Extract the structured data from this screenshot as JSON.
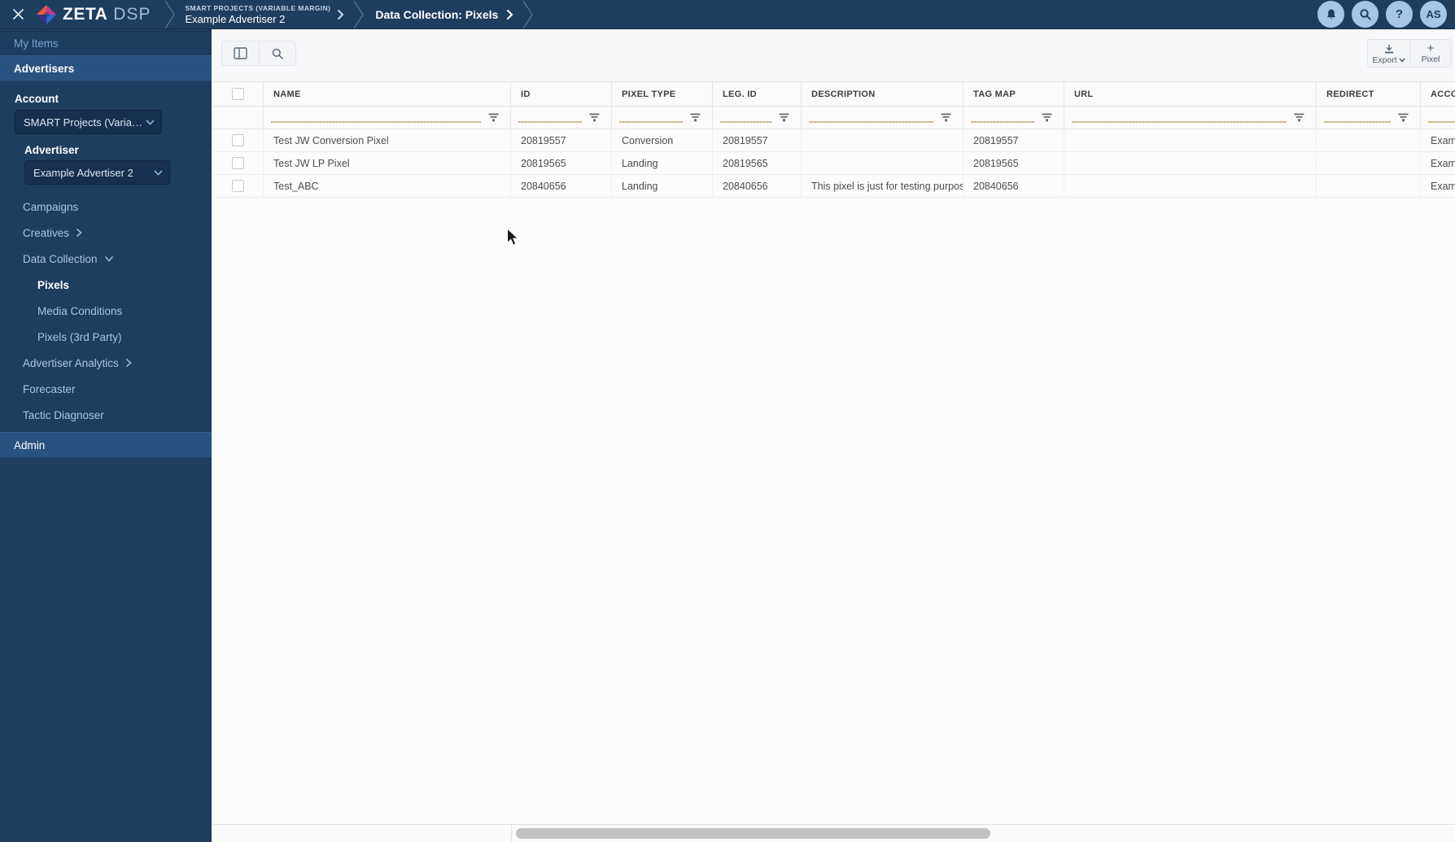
{
  "topbar": {
    "brand_zeta": "ZETA",
    "brand_dsp": "DSP",
    "breadcrumb": {
      "account": "SMART PROJECTS (VARIABLE MARGIN)",
      "advertiser": "Example Advertiser 2",
      "page": "Data Collection: Pixels"
    },
    "help_glyph": "?",
    "avatar": "AS"
  },
  "sidebar": {
    "my_items": "My Items",
    "advertisers": "Advertisers",
    "account_label": "Account",
    "account_value": "SMART Projects (Variable M...",
    "advertiser_label": "Advertiser",
    "advertiser_value": "Example Advertiser 2",
    "items": [
      {
        "label": "Campaigns"
      },
      {
        "label": "Creatives"
      },
      {
        "label": "Data Collection"
      },
      {
        "label": "Pixels"
      },
      {
        "label": "Media Conditions"
      },
      {
        "label": "Pixels (3rd Party)"
      },
      {
        "label": "Advertiser Analytics"
      },
      {
        "label": "Forecaster"
      },
      {
        "label": "Tactic Diagnoser"
      }
    ],
    "admin": "Admin"
  },
  "toolbar": {
    "export_label": "Export",
    "pixel_label": "Pixel",
    "plus_glyph": "+"
  },
  "table": {
    "columns": [
      "NAME",
      "ID",
      "PIXEL TYPE",
      "LEG. ID",
      "DESCRIPTION",
      "TAG MAP",
      "URL",
      "REDIRECT",
      "ACCOUNT"
    ],
    "rows": [
      {
        "name": "Test JW Conversion Pixel",
        "id": "20819557",
        "pixel_type": "Conversion",
        "leg_id": "20819557",
        "description": "",
        "tag_map": "20819557",
        "url": "",
        "redirect": "",
        "account": "Example A"
      },
      {
        "name": "Test JW LP Pixel",
        "id": "20819565",
        "pixel_type": "Landing",
        "leg_id": "20819565",
        "description": "",
        "tag_map": "20819565",
        "url": "",
        "redirect": "",
        "account": "Example A"
      },
      {
        "name": "Test_ABC",
        "id": "20840656",
        "pixel_type": "Landing",
        "leg_id": "20840656",
        "description": "This pixel is just for testing purpose",
        "tag_map": "20840656",
        "url": "",
        "redirect": "",
        "account": "Example A"
      }
    ]
  },
  "colors": {
    "navy": "#1e3e5f",
    "band_highlight": "#2a527e",
    "circle_accent": "#a6c5e7"
  }
}
